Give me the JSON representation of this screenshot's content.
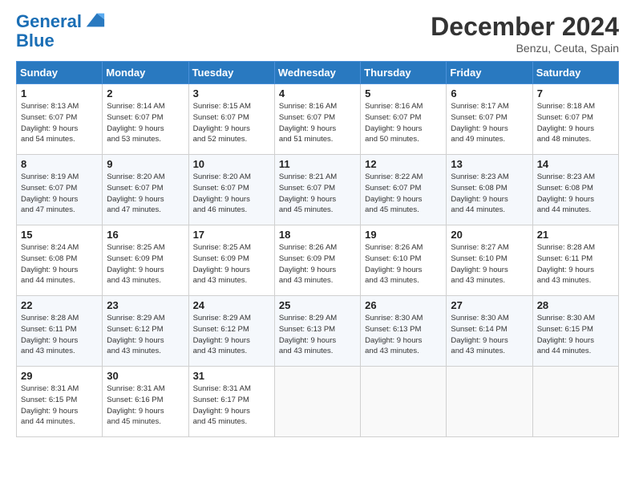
{
  "logo": {
    "line1": "General",
    "line2": "Blue"
  },
  "title": "December 2024",
  "location": "Benzu, Ceuta, Spain",
  "weekdays": [
    "Sunday",
    "Monday",
    "Tuesday",
    "Wednesday",
    "Thursday",
    "Friday",
    "Saturday"
  ],
  "weeks": [
    [
      {
        "day": "1",
        "sunrise": "8:13 AM",
        "sunset": "6:07 PM",
        "daylight": "9 hours and 54 minutes."
      },
      {
        "day": "2",
        "sunrise": "8:14 AM",
        "sunset": "6:07 PM",
        "daylight": "9 hours and 53 minutes."
      },
      {
        "day": "3",
        "sunrise": "8:15 AM",
        "sunset": "6:07 PM",
        "daylight": "9 hours and 52 minutes."
      },
      {
        "day": "4",
        "sunrise": "8:16 AM",
        "sunset": "6:07 PM",
        "daylight": "9 hours and 51 minutes."
      },
      {
        "day": "5",
        "sunrise": "8:16 AM",
        "sunset": "6:07 PM",
        "daylight": "9 hours and 50 minutes."
      },
      {
        "day": "6",
        "sunrise": "8:17 AM",
        "sunset": "6:07 PM",
        "daylight": "9 hours and 49 minutes."
      },
      {
        "day": "7",
        "sunrise": "8:18 AM",
        "sunset": "6:07 PM",
        "daylight": "9 hours and 48 minutes."
      }
    ],
    [
      {
        "day": "8",
        "sunrise": "8:19 AM",
        "sunset": "6:07 PM",
        "daylight": "9 hours and 47 minutes."
      },
      {
        "day": "9",
        "sunrise": "8:20 AM",
        "sunset": "6:07 PM",
        "daylight": "9 hours and 47 minutes."
      },
      {
        "day": "10",
        "sunrise": "8:20 AM",
        "sunset": "6:07 PM",
        "daylight": "9 hours and 46 minutes."
      },
      {
        "day": "11",
        "sunrise": "8:21 AM",
        "sunset": "6:07 PM",
        "daylight": "9 hours and 45 minutes."
      },
      {
        "day": "12",
        "sunrise": "8:22 AM",
        "sunset": "6:07 PM",
        "daylight": "9 hours and 45 minutes."
      },
      {
        "day": "13",
        "sunrise": "8:23 AM",
        "sunset": "6:08 PM",
        "daylight": "9 hours and 44 minutes."
      },
      {
        "day": "14",
        "sunrise": "8:23 AM",
        "sunset": "6:08 PM",
        "daylight": "9 hours and 44 minutes."
      }
    ],
    [
      {
        "day": "15",
        "sunrise": "8:24 AM",
        "sunset": "6:08 PM",
        "daylight": "9 hours and 44 minutes."
      },
      {
        "day": "16",
        "sunrise": "8:25 AM",
        "sunset": "6:09 PM",
        "daylight": "9 hours and 43 minutes."
      },
      {
        "day": "17",
        "sunrise": "8:25 AM",
        "sunset": "6:09 PM",
        "daylight": "9 hours and 43 minutes."
      },
      {
        "day": "18",
        "sunrise": "8:26 AM",
        "sunset": "6:09 PM",
        "daylight": "9 hours and 43 minutes."
      },
      {
        "day": "19",
        "sunrise": "8:26 AM",
        "sunset": "6:10 PM",
        "daylight": "9 hours and 43 minutes."
      },
      {
        "day": "20",
        "sunrise": "8:27 AM",
        "sunset": "6:10 PM",
        "daylight": "9 hours and 43 minutes."
      },
      {
        "day": "21",
        "sunrise": "8:28 AM",
        "sunset": "6:11 PM",
        "daylight": "9 hours and 43 minutes."
      }
    ],
    [
      {
        "day": "22",
        "sunrise": "8:28 AM",
        "sunset": "6:11 PM",
        "daylight": "9 hours and 43 minutes."
      },
      {
        "day": "23",
        "sunrise": "8:29 AM",
        "sunset": "6:12 PM",
        "daylight": "9 hours and 43 minutes."
      },
      {
        "day": "24",
        "sunrise": "8:29 AM",
        "sunset": "6:12 PM",
        "daylight": "9 hours and 43 minutes."
      },
      {
        "day": "25",
        "sunrise": "8:29 AM",
        "sunset": "6:13 PM",
        "daylight": "9 hours and 43 minutes."
      },
      {
        "day": "26",
        "sunrise": "8:30 AM",
        "sunset": "6:13 PM",
        "daylight": "9 hours and 43 minutes."
      },
      {
        "day": "27",
        "sunrise": "8:30 AM",
        "sunset": "6:14 PM",
        "daylight": "9 hours and 43 minutes."
      },
      {
        "day": "28",
        "sunrise": "8:30 AM",
        "sunset": "6:15 PM",
        "daylight": "9 hours and 44 minutes."
      }
    ],
    [
      {
        "day": "29",
        "sunrise": "8:31 AM",
        "sunset": "6:15 PM",
        "daylight": "9 hours and 44 minutes."
      },
      {
        "day": "30",
        "sunrise": "8:31 AM",
        "sunset": "6:16 PM",
        "daylight": "9 hours and 45 minutes."
      },
      {
        "day": "31",
        "sunrise": "8:31 AM",
        "sunset": "6:17 PM",
        "daylight": "9 hours and 45 minutes."
      },
      null,
      null,
      null,
      null
    ]
  ]
}
